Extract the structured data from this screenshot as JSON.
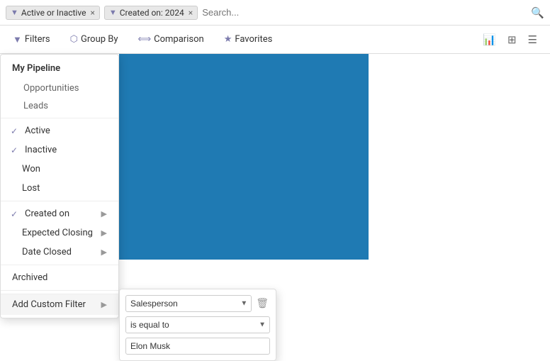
{
  "search_bar": {
    "filter_tag_1": "Active or Inactive",
    "filter_tag_2": "Created on: 2024",
    "search_placeholder": "Search..."
  },
  "toolbar": {
    "filters_label": "Filters",
    "group_by_label": "Group By",
    "comparison_label": "Comparison",
    "favorites_label": "Favorites"
  },
  "dropdown": {
    "my_pipeline": "My Pipeline",
    "opportunities": "Opportunities",
    "leads": "Leads",
    "active": "Active",
    "inactive": "Inactive",
    "won": "Won",
    "lost": "Lost",
    "created_on": "Created on",
    "expected_closing": "Expected Closing",
    "date_closed": "Date Closed",
    "archived": "Archived",
    "add_custom_filter": "Add Custom Filter"
  },
  "custom_filter": {
    "field": "Salesperson",
    "operator": "is equal to",
    "value": "Elon Musk"
  }
}
